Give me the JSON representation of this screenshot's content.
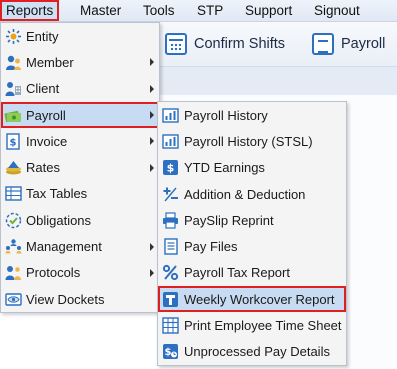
{
  "menubar": {
    "items": [
      "Reports",
      "Master",
      "Tools",
      "STP",
      "Support",
      "Signout"
    ]
  },
  "toolbar": {
    "confirm_shifts_label": "Confirm Shifts",
    "payroll_label": "Payroll"
  },
  "reports_menu": {
    "items": [
      {
        "label": "Entity",
        "icon": "entity-icon"
      },
      {
        "label": "Member",
        "icon": "member-icon"
      },
      {
        "label": "Client",
        "icon": "client-icon"
      },
      {
        "label": "Payroll",
        "icon": "payroll-icon"
      },
      {
        "label": "Invoice",
        "icon": "invoice-icon"
      },
      {
        "label": "Rates",
        "icon": "rates-icon"
      },
      {
        "label": "Tax Tables",
        "icon": "tax-tables-icon"
      },
      {
        "label": "Obligations",
        "icon": "obligations-icon"
      },
      {
        "label": "Management",
        "icon": "management-icon"
      },
      {
        "label": "Protocols",
        "icon": "protocols-icon"
      },
      {
        "label": "View Dockets",
        "icon": "view-dockets-icon"
      }
    ]
  },
  "payroll_submenu": {
    "items": [
      {
        "label": "Payroll History",
        "icon": "payroll-history-icon"
      },
      {
        "label": "Payroll History (STSL)",
        "icon": "payroll-history-stsl-icon"
      },
      {
        "label": "YTD Earnings",
        "icon": "ytd-earnings-icon"
      },
      {
        "label": "Addition & Deduction",
        "icon": "addition-deduction-icon"
      },
      {
        "label": "PaySlip Reprint",
        "icon": "printer-icon"
      },
      {
        "label": "Pay Files",
        "icon": "pay-files-icon"
      },
      {
        "label": "Payroll Tax Report",
        "icon": "percent-icon"
      },
      {
        "label": "Weekly Workcover Report",
        "icon": "workcover-icon"
      },
      {
        "label": "Print Employee Time Sheet",
        "icon": "timesheet-icon"
      },
      {
        "label": "Unprocessed Pay Details",
        "icon": "unprocessed-pay-icon"
      }
    ]
  },
  "colors": {
    "highlight_outline": "#e02020",
    "highlight_fill": "#c7dcf2",
    "menu_background": "#f4f4f4",
    "icon_blue": "#2d6fc0"
  }
}
